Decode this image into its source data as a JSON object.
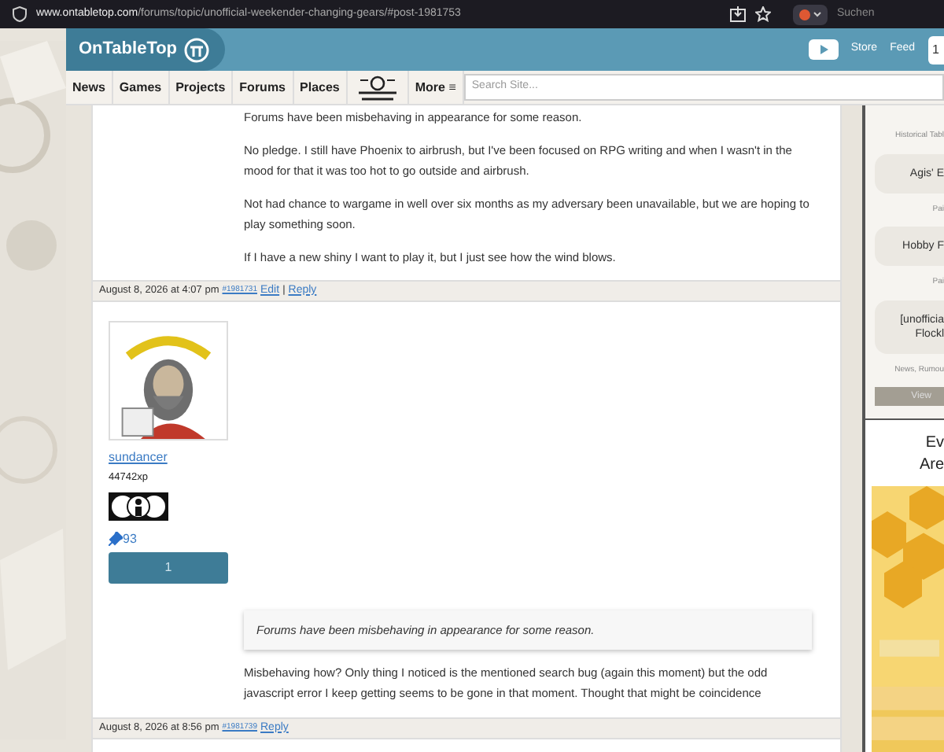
{
  "browser": {
    "url_host": "www.ontabletop.com",
    "url_path": "/forums/topic/unofficial-weekender-changing-gears/#post-1981753",
    "search_placeholder": "Suchen"
  },
  "header": {
    "logo": "OnTableTop",
    "links": [
      "Store",
      "Feed"
    ],
    "badge": "1"
  },
  "nav": {
    "items": [
      {
        "label": "News",
        "kind": "text"
      },
      {
        "label": "Games",
        "kind": "text"
      },
      {
        "label": "Projects",
        "kind": "text"
      },
      {
        "label": "Forums",
        "kind": "text"
      },
      {
        "label": "Places",
        "kind": "text"
      },
      {
        "kind": "logo"
      },
      {
        "label": "More ≡",
        "kind": "text"
      }
    ],
    "search_placeholder": "Search Site..."
  },
  "posts": [
    {
      "paragraphs": [
        "Forums have been misbehaving in appearance for some reason.",
        "No pledge. I still have Phoenix to airbrush, but I've been focused on RPG writing and when I wasn't in the mood for that it was too hot to go outside and airbrush.",
        "Not had chance to wargame in well over six months as my adversary been unavailable, but we are hoping to play something soon.",
        "If I have a new shiny I want to play it, but I just see how the wind blows."
      ],
      "footer": {
        "date": "August 8, 2026 at 4:07 pm",
        "id": "#1981731",
        "actions": [
          "Edit",
          "Reply"
        ],
        "separator": "|"
      }
    },
    {
      "author": {
        "name": "sundancer",
        "xp": "44742xp",
        "pins": "93",
        "button": "1"
      },
      "quote": "Forums have been misbehaving in appearance for some reason.",
      "paragraphs": [
        "Misbehaving how? Only thing I noticed is the mentioned search bug (again this moment) but the odd javascript error I keep getting seems to be gone in that moment. Thought that might be coincidence"
      ],
      "footer": {
        "date": "August 8, 2026 at 8:56 pm",
        "id": "#1981739",
        "actions": [
          "Reply"
        ]
      }
    }
  ],
  "sidebar": {
    "items": [
      {
        "kind": "label",
        "text": "Historical Tabl"
      },
      {
        "kind": "card",
        "lines": [
          "Agis' E"
        ]
      },
      {
        "kind": "label",
        "text": "Pai"
      },
      {
        "kind": "card",
        "lines": [
          "Hobby F"
        ]
      },
      {
        "kind": "label",
        "text": "Pai"
      },
      {
        "kind": "card",
        "lines": [
          "[unofficia",
          "Flockl"
        ]
      },
      {
        "kind": "label",
        "text": "News, Rumou"
      },
      {
        "kind": "button",
        "text": "View"
      }
    ],
    "heading": [
      "Ev",
      "Are"
    ]
  }
}
